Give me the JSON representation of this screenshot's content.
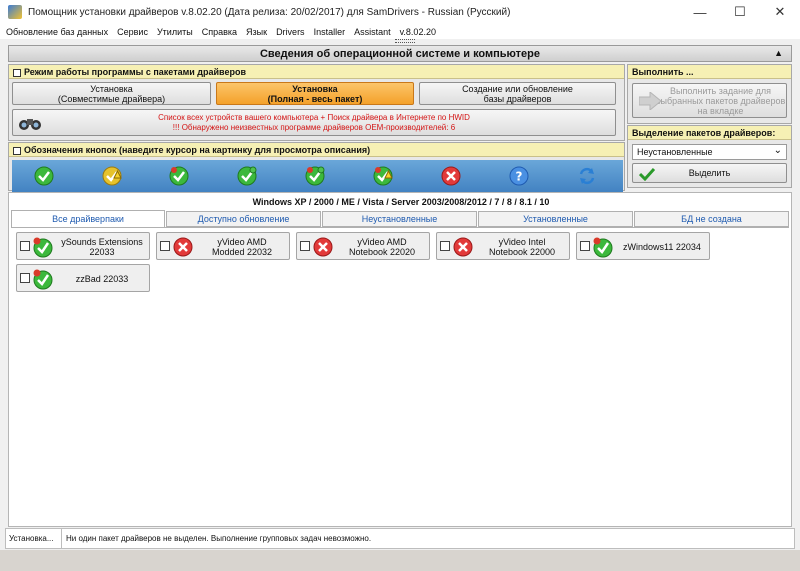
{
  "window": {
    "title": "Помощник установки драйверов v.8.02.20 (Дата релиза: 20/02/2017) для SamDrivers - Russian (Русский)",
    "minimize": "—",
    "maximize": "☐",
    "close": "✕"
  },
  "menu": [
    "Обновление баз данных",
    "Сервис",
    "Утилиты",
    "Справка",
    "Язык",
    "Drivers",
    "Installer",
    "Assistant",
    "v.8.02.20"
  ],
  "header": {
    "title": "Сведения об операционной системе и компьютере",
    "arrow": "▲"
  },
  "mode_group": {
    "title": "Режим работы программы с пакетами драйверов",
    "btn_compat_line1": "Установка",
    "btn_compat_line2": "(Совместимые драйвера)",
    "btn_full_line1": "Установка",
    "btn_full_line2": "(Полная - весь пакет)",
    "btn_create_line1": "Создание или обновление",
    "btn_create_line2": "базы драйверов",
    "info_line1": "Список всех устройств вашего компьютера + Поиск драйвера в Интернете по HWID",
    "info_line2": "!!! Обнаружено неизвестных программе драйверов OEM-производителей: 6"
  },
  "execute_group": {
    "title": "Выполнить ...",
    "btn_line1": "Выполнить задание для",
    "btn_line2": "выбранных пакетов драйверов",
    "btn_line3": "на вкладке"
  },
  "selection_group": {
    "title": "Выделение пакетов драйверов:",
    "dropdown_value": "Неустановленные",
    "dropdown_arrow": "⌄",
    "select_btn": "Выделить"
  },
  "legend_group": {
    "title": "Обозначения кнопок (наведите курсор на картинку для просмотра описания)",
    "icons": [
      "check-green-icon",
      "check-warning-icon",
      "check-update-icon",
      "check-green-icon",
      "check-green-update-icon",
      "check-warning-update-icon",
      "error-icon",
      "help-icon",
      "refresh-icon"
    ]
  },
  "os_label": "Windows XP / 2000 / ME / Vista / Server 2003/2008/2012 / 7 / 8 / 8.1 / 10",
  "tabs": [
    "Все драйверпаки",
    "Доступно обновление",
    "Неустановленные",
    "Установленные",
    "БД не создана"
  ],
  "packages": [
    {
      "line1": "ySounds Extensions",
      "line2": "22033",
      "icon": "check-update-icon"
    },
    {
      "line1": "yVideo AMD",
      "line2": "Modded 22032",
      "icon": "error-icon"
    },
    {
      "line1": "yVideo AMD",
      "line2": "Notebook 22020",
      "icon": "error-icon"
    },
    {
      "line1": "yVideo Intel",
      "line2": "Notebook 22000",
      "icon": "error-icon"
    },
    {
      "line1": "zWindows11 22034",
      "line2": "",
      "icon": "check-update-icon"
    },
    {
      "line1": "zzBad 22033",
      "line2": "",
      "icon": "check-update-icon"
    }
  ],
  "status": {
    "left": "Установка...",
    "message": "Ни один пакет драйверов не выделен. Выполнение групповых задач невозможно."
  },
  "colors": {
    "accent_orange": "#f4a12a",
    "group_title_bg": "#f6f0b4",
    "legend_blue": "#3f7fc0",
    "tab_text": "#1f5bb0",
    "warning_red": "#d41515"
  }
}
